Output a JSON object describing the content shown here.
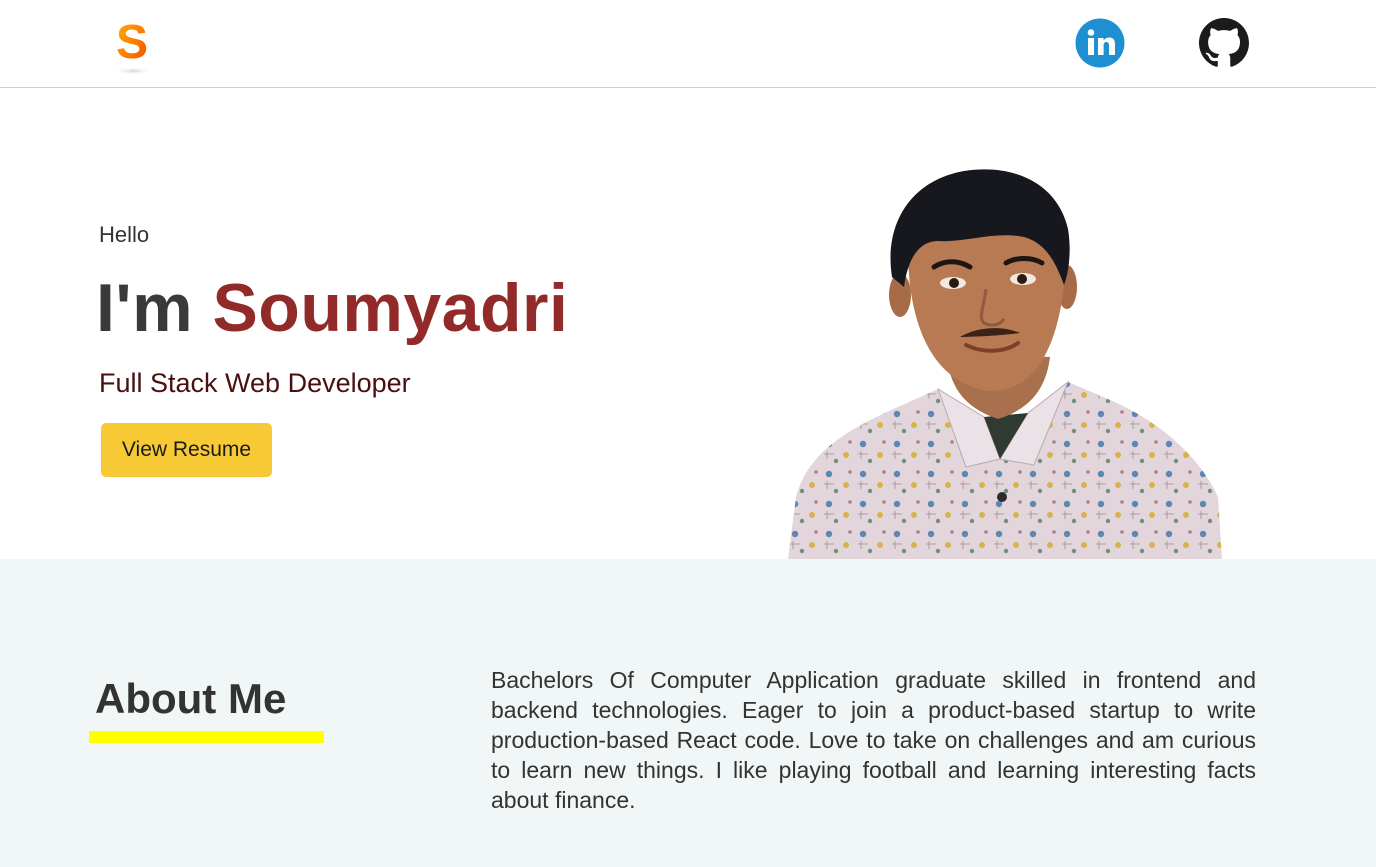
{
  "header": {
    "logo_letter": "S",
    "social": [
      {
        "name": "linkedin",
        "icon": "linkedin-icon",
        "color": "#1e8fd0"
      },
      {
        "name": "github",
        "icon": "github-icon",
        "color": "#1b1b1b"
      }
    ]
  },
  "hero": {
    "greeting": "Hello",
    "intro": "I'm",
    "name": "Soumyadri",
    "role": "Full Stack Web Developer",
    "resume_button": "View Resume",
    "colors": {
      "name": "#922a2a",
      "role": "#4a0f0f",
      "button": "#f7ca35"
    }
  },
  "about": {
    "title": "About Me",
    "text": "Bachelors Of Computer Application graduate skilled in frontend and backend technologies. Eager to join a product-based startup to write production-based React code. Love to take on challenges and am curious to learn new things. I like playing football and learning interesting facts about finance.",
    "colors": {
      "underline": "#ffff00",
      "background": "#f1f6f6"
    }
  }
}
